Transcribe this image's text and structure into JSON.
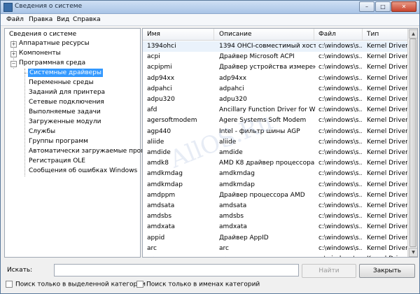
{
  "window": {
    "title": "Сведения о системе"
  },
  "window_buttons": {
    "minimize": "–",
    "maximize": "□",
    "close": "✕"
  },
  "menu": [
    "Файл",
    "Правка",
    "Вид",
    "Справка"
  ],
  "tree": {
    "root": "Сведения о системе",
    "items": [
      "Аппаратные ресурсы",
      "Компоненты",
      "Программная среда"
    ],
    "children": [
      "Системные драйверы",
      "Переменные среды",
      "Заданий для принтера",
      "Сетевые подключения",
      "Выполняемые задачи",
      "Загруженные модули",
      "Службы",
      "Группы программ",
      "Автоматически загружаемые програм",
      "Регистрация OLE",
      "Сообщения об ошибках Windows"
    ]
  },
  "list": {
    "columns": [
      "Имя",
      "Описание",
      "Файл",
      "Тип"
    ],
    "rows": [
      [
        "1394ohci",
        "1394 OHCI-совместимый хост...",
        "c:\\windows\\s...",
        "Kernel Driver"
      ],
      [
        "acpi",
        "Драйвер Microsoft ACPI",
        "c:\\windows\\s...",
        "Kernel Driver"
      ],
      [
        "acpipmi",
        "Драйвер устройства измерен...",
        "c:\\windows\\s...",
        "Kernel Driver"
      ],
      [
        "adp94xx",
        "adp94xx",
        "c:\\windows\\s...",
        "Kernel Driver"
      ],
      [
        "adpahci",
        "adpahci",
        "c:\\windows\\s...",
        "Kernel Driver"
      ],
      [
        "adpu320",
        "adpu320",
        "c:\\windows\\s...",
        "Kernel Driver"
      ],
      [
        "afd",
        "Ancillary Function Driver for Wi...",
        "c:\\windows\\s...",
        "Kernel Driver"
      ],
      [
        "agersoftmodem",
        "Agere Systems Soft Modem",
        "c:\\windows\\s...",
        "Kernel Driver"
      ],
      [
        "agp440",
        "Intel - фильтр шины AGP",
        "c:\\windows\\s...",
        "Kernel Driver"
      ],
      [
        "aliide",
        "aliide",
        "c:\\windows\\s...",
        "Kernel Driver"
      ],
      [
        "amdide",
        "amdide",
        "c:\\windows\\s...",
        "Kernel Driver"
      ],
      [
        "amdk8",
        "AMD K8 драйвер процессора",
        "c:\\windows\\s...",
        "Kernel Driver"
      ],
      [
        "amdkmdag",
        "amdkmdag",
        "c:\\windows\\s...",
        "Kernel Driver"
      ],
      [
        "amdkmdap",
        "amdkmdap",
        "c:\\windows\\s...",
        "Kernel Driver"
      ],
      [
        "amdppm",
        "Драйвер процессора AMD",
        "c:\\windows\\s...",
        "Kernel Driver"
      ],
      [
        "amdsata",
        "amdsata",
        "c:\\windows\\s...",
        "Kernel Driver"
      ],
      [
        "amdsbs",
        "amdsbs",
        "c:\\windows\\s...",
        "Kernel Driver"
      ],
      [
        "amdxata",
        "amdxata",
        "c:\\windows\\s...",
        "Kernel Driver"
      ],
      [
        "appid",
        "Драйвер AppID",
        "c:\\windows\\s...",
        "Kernel Driver"
      ],
      [
        "arc",
        "arc",
        "c:\\windows\\s...",
        "Kernel Driver"
      ],
      [
        "arcsas",
        "arcsas",
        "c:\\windows\\s...",
        "Kernel Driver"
      ]
    ]
  },
  "search": {
    "label": "Искать:",
    "value": "",
    "find_button": "Найти",
    "close_button": "Закрыть",
    "option_selected": "Поиск только в выделенной категории",
    "option_names": "Поиск только в именах категорий"
  },
  "watermark": "AllOS.Ru"
}
